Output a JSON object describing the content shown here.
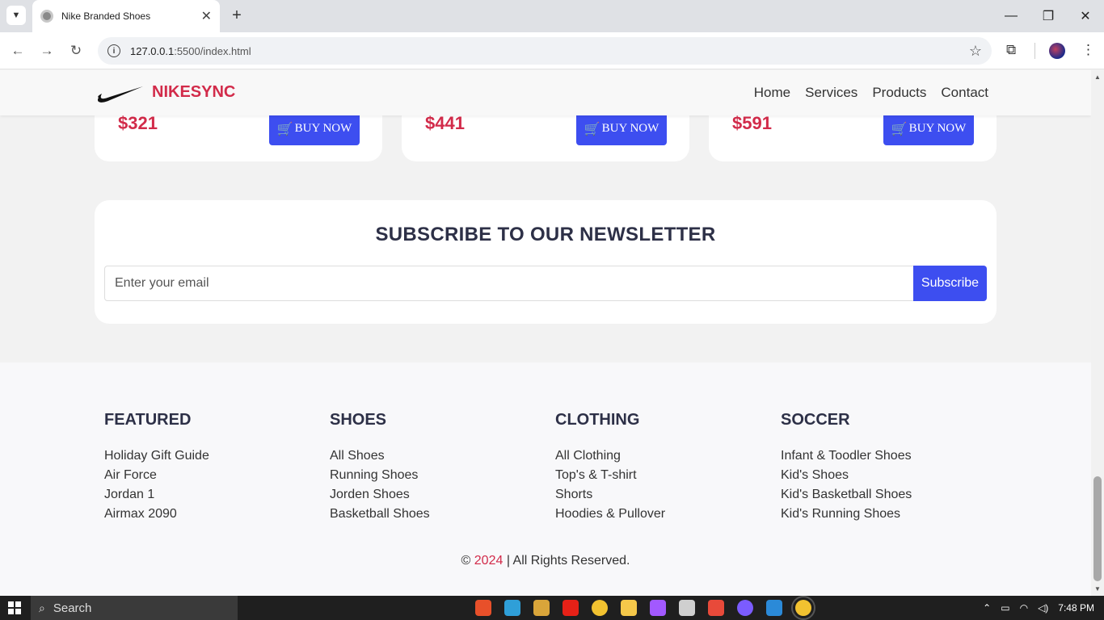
{
  "browser": {
    "tab_title": "Nike Branded Shoes",
    "url_host": "127.0.0.1",
    "url_path": ":5500/index.html"
  },
  "navbar": {
    "brand": "NIKESYNC",
    "menu": [
      "Home",
      "Services",
      "Products",
      "Contact"
    ]
  },
  "products": [
    {
      "price": "$321",
      "buy_label": "BUY NOW"
    },
    {
      "price": "$441",
      "buy_label": "BUY NOW"
    },
    {
      "price": "$591",
      "buy_label": "BUY NOW"
    }
  ],
  "newsletter": {
    "heading": "SUBSCRIBE TO OUR NEWSLETTER",
    "email_placeholder": "Enter your email",
    "subscribe_label": "Subscribe"
  },
  "footer": {
    "columns": [
      {
        "title": "FEATURED",
        "links": [
          "Holiday Gift Guide",
          "Air Force",
          "Jordan 1",
          "Airmax 2090"
        ]
      },
      {
        "title": "SHOES",
        "links": [
          "All Shoes",
          "Running Shoes",
          "Jorden Shoes",
          "Basketball Shoes"
        ]
      },
      {
        "title": "CLOTHING",
        "links": [
          "All Clothing",
          "Top's & T-shirt",
          "Shorts",
          "Hoodies & Pullover"
        ]
      },
      {
        "title": "SOCCER",
        "links": [
          "Infant & Toodler Shoes",
          "Kid's Shoes",
          "Kid's Basketball Shoes",
          "Kid's Running Shoes"
        ]
      }
    ],
    "copyright_prefix": "©",
    "copyright_year": "2024",
    "copyright_suffix": "| All Rights Reserved."
  },
  "taskbar": {
    "search_label": "Search",
    "time": "7:48 PM"
  },
  "colors": {
    "brand": "#d22b4a",
    "accent": "#3d4ef0",
    "heading": "#2d3047"
  }
}
